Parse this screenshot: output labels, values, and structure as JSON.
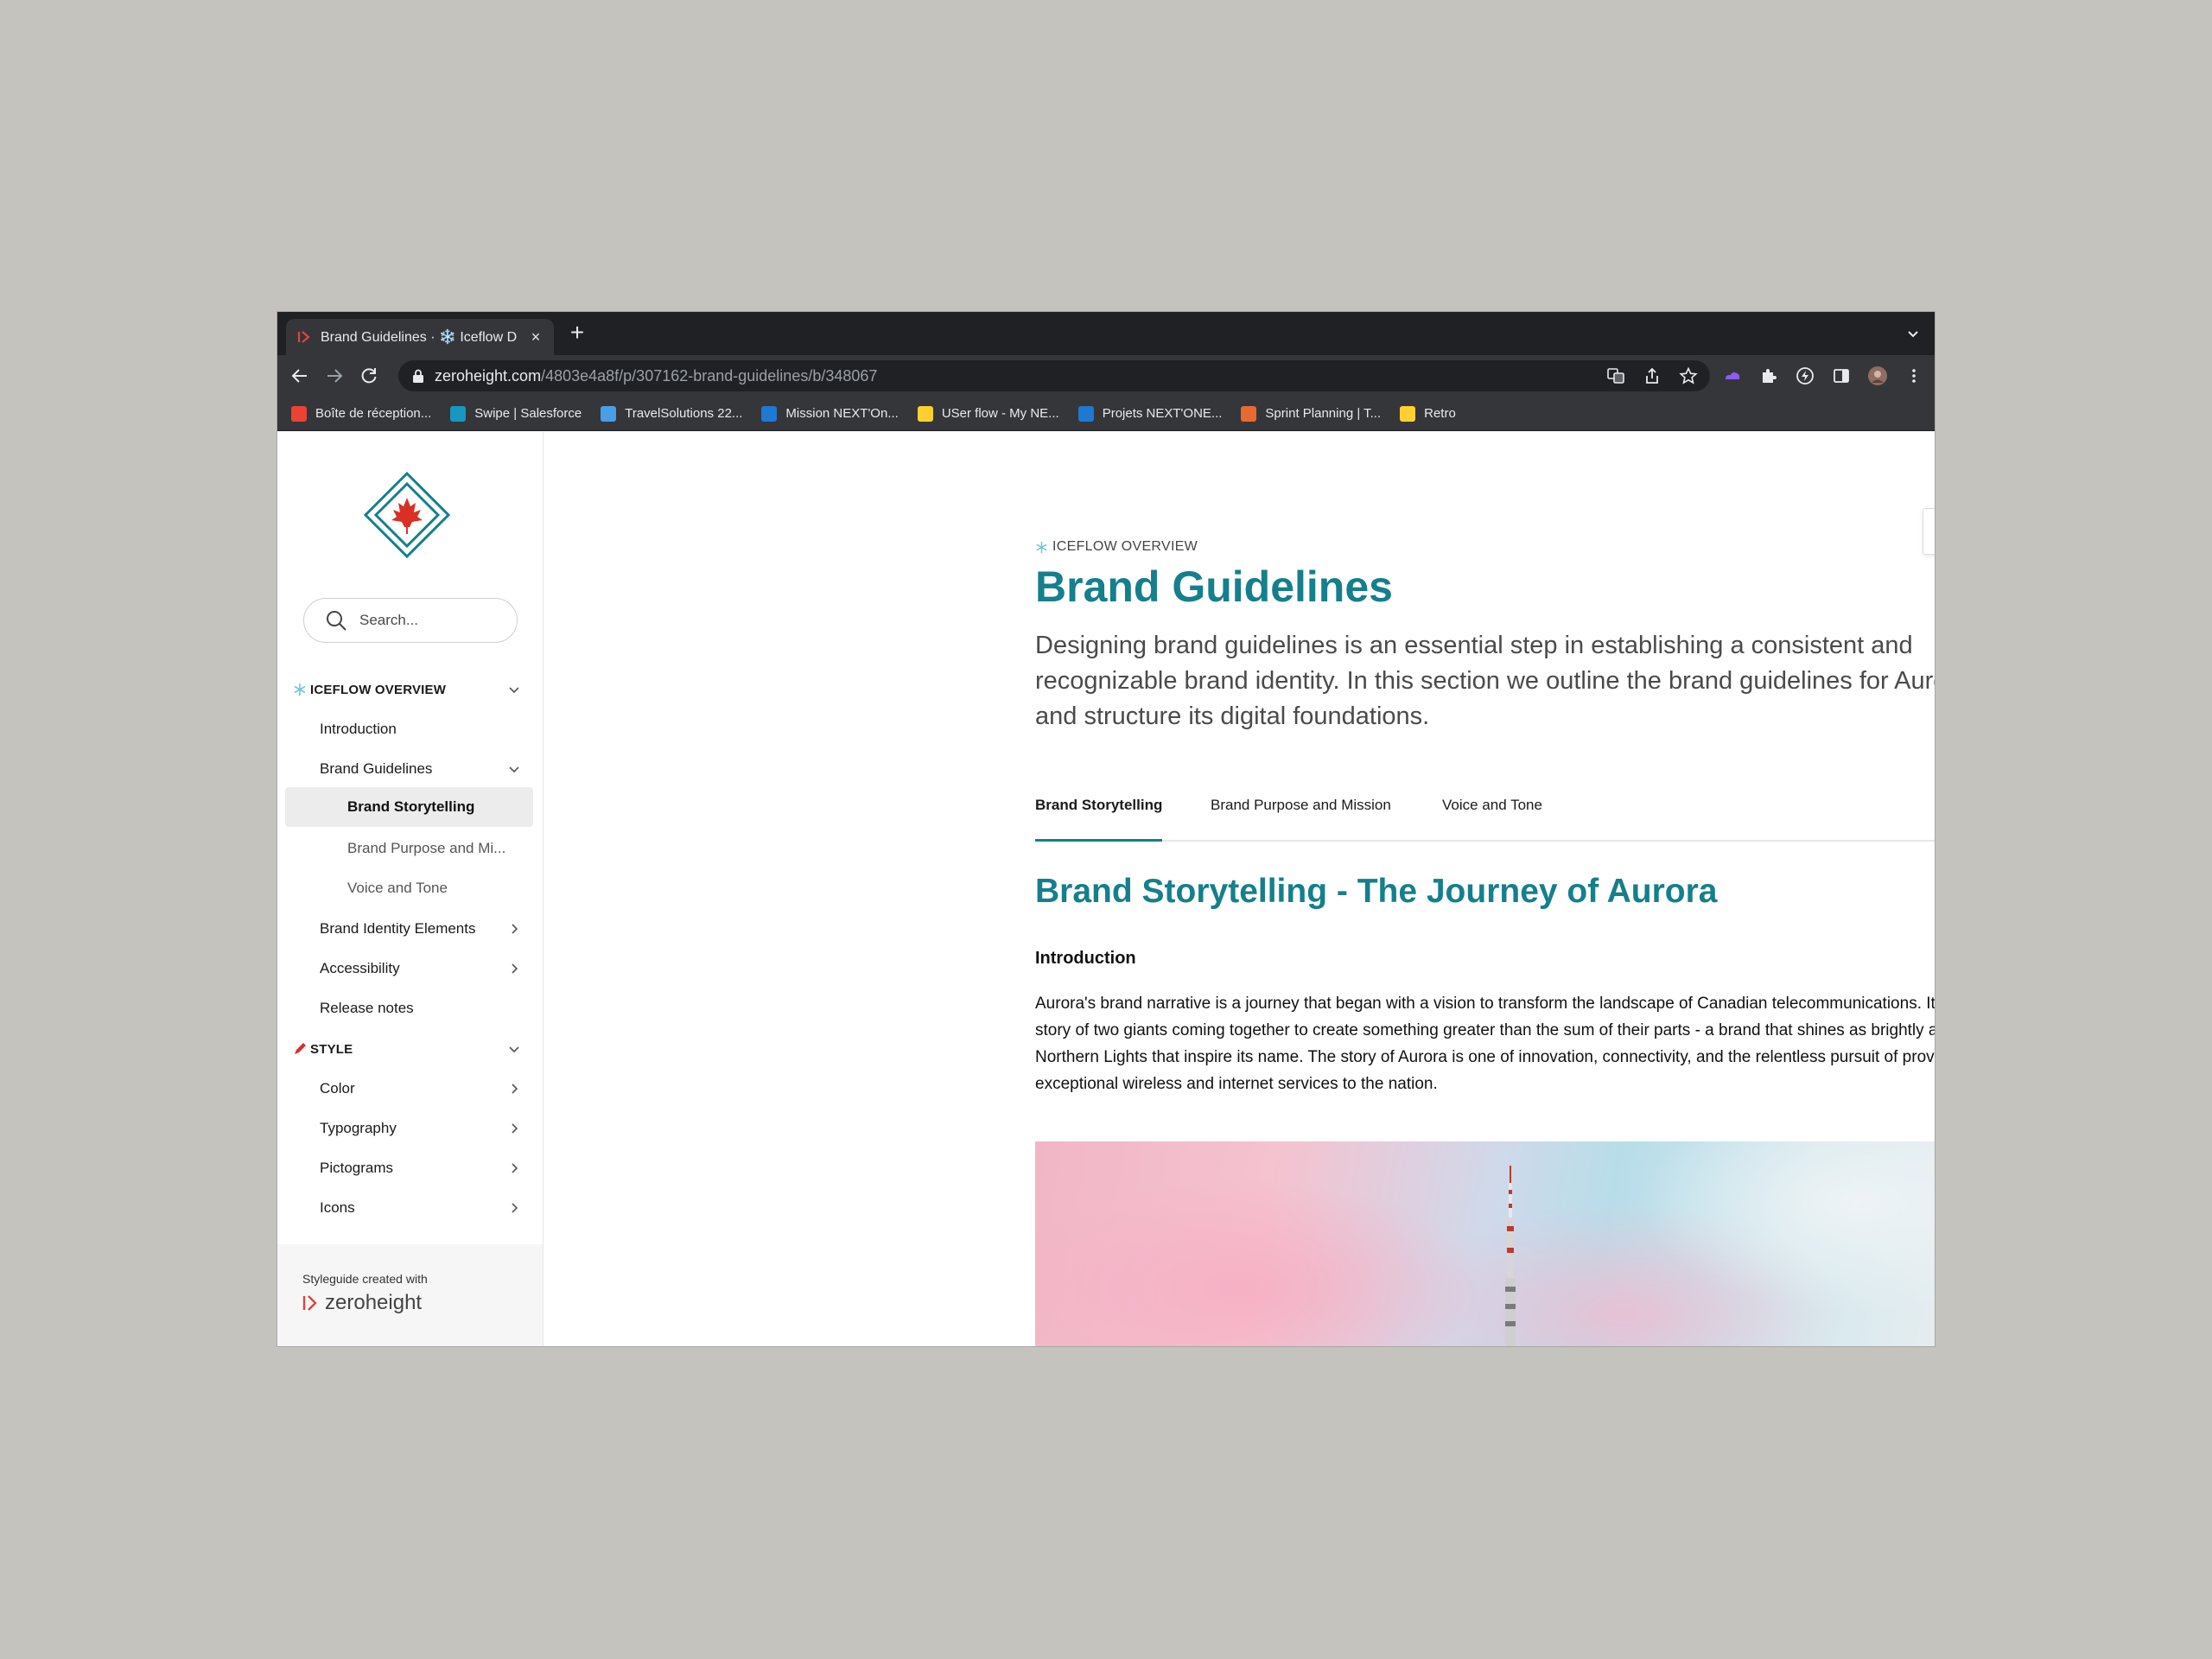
{
  "browser": {
    "tab": {
      "title": "Brand Guidelines · ❄️ Iceflow D",
      "close": "×"
    },
    "new_tab": "+",
    "url": {
      "host": "zeroheight.com",
      "path": "/4803e4a8f/p/307162-brand-guidelines/b/348067"
    },
    "bookmarks": [
      {
        "label": "Boîte de réception...",
        "icon": "gmail-icon",
        "color": "#ea4335"
      },
      {
        "label": "Swipe | Salesforce",
        "icon": "salesforce-icon",
        "color": "#1798c1"
      },
      {
        "label": "TravelSolutions 22...",
        "icon": "folder-icon",
        "color": "#4a9ee6"
      },
      {
        "label": "Mission NEXT'On...",
        "icon": "trello-icon",
        "color": "#1f78d1"
      },
      {
        "label": "USer flow - My NE...",
        "icon": "miro-icon",
        "color": "#ffd02f"
      },
      {
        "label": "Projets NEXT'ONE...",
        "icon": "trello-icon",
        "color": "#1f78d1"
      },
      {
        "label": "Sprint Planning | T...",
        "icon": "retro-icon",
        "color": "#e86a33"
      },
      {
        "label": "Retro",
        "icon": "miro-icon",
        "color": "#ffd02f"
      }
    ]
  },
  "sidebar": {
    "search_placeholder": "Search...",
    "sections": {
      "overview": "ICEFLOW OVERVIEW",
      "style": "STYLE"
    },
    "items": {
      "introduction": "Introduction",
      "brand_guidelines": "Brand Guidelines",
      "brand_storytelling": "Brand Storytelling",
      "brand_purpose": "Brand Purpose and Mi...",
      "voice_tone": "Voice and Tone",
      "brand_identity": "Brand Identity Elements",
      "accessibility": "Accessibility",
      "release_notes": "Release notes",
      "color": "Color",
      "typography": "Typography",
      "pictograms": "Pictograms",
      "icons": "Icons"
    },
    "footer": {
      "made_with": "Styleguide created with",
      "brand": "zeroheight"
    }
  },
  "content": {
    "breadcrumb": "ICEFLOW OVERVIEW",
    "title": "Brand Guidelines",
    "lead": "Designing brand guidelines is an essential step in establishing a consistent and recognizable brand identity. In this section we outline the brand guidelines for Aurora and structure its digital foundations.",
    "tabs": [
      "Brand Storytelling",
      "Brand Purpose and Mission",
      "Voice and Tone"
    ],
    "selected_tab": "Brand Storytelling",
    "heading": "Brand Storytelling - The Journey of Aurora",
    "subheading": "Introduction",
    "paragraph": "Aurora's brand narrative is a journey that began with a vision to transform the landscape of Canadian telecommunications. It is a story of two giants coming together to create something greater than the sum of their parts - a brand that shines as brightly as the Northern Lights that inspire its name. The story of Aurora is one of innovation, connectivity, and the relentless pursuit of providing exceptional wireless and internet services to the nation."
  },
  "colors": {
    "accent": "#157f8c",
    "chrome_dark": "#202124",
    "chrome": "#35363a",
    "logo_red": "#d93025"
  }
}
